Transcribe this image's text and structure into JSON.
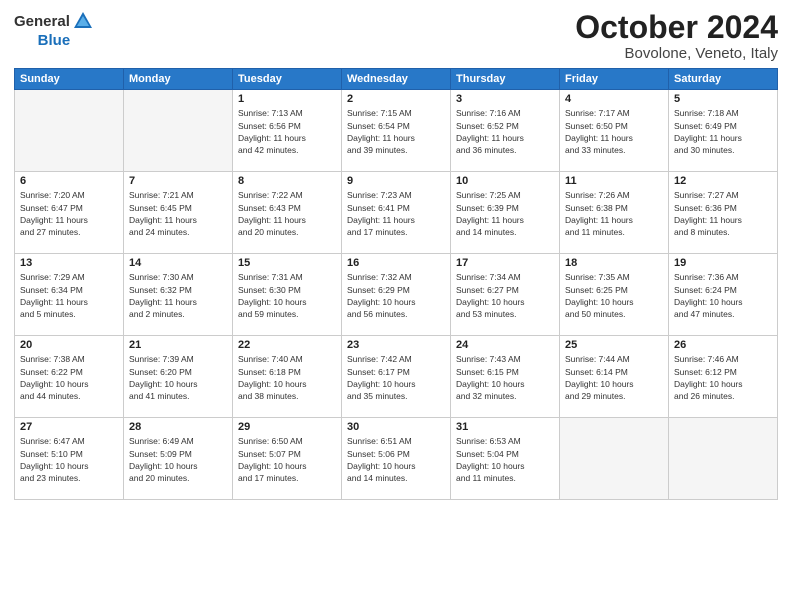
{
  "header": {
    "logo_general": "General",
    "logo_blue": "Blue",
    "month": "October 2024",
    "location": "Bovolone, Veneto, Italy"
  },
  "weekdays": [
    "Sunday",
    "Monday",
    "Tuesday",
    "Wednesday",
    "Thursday",
    "Friday",
    "Saturday"
  ],
  "weeks": [
    [
      {
        "day": "",
        "info": ""
      },
      {
        "day": "",
        "info": ""
      },
      {
        "day": "1",
        "info": "Sunrise: 7:13 AM\nSunset: 6:56 PM\nDaylight: 11 hours\nand 42 minutes."
      },
      {
        "day": "2",
        "info": "Sunrise: 7:15 AM\nSunset: 6:54 PM\nDaylight: 11 hours\nand 39 minutes."
      },
      {
        "day": "3",
        "info": "Sunrise: 7:16 AM\nSunset: 6:52 PM\nDaylight: 11 hours\nand 36 minutes."
      },
      {
        "day": "4",
        "info": "Sunrise: 7:17 AM\nSunset: 6:50 PM\nDaylight: 11 hours\nand 33 minutes."
      },
      {
        "day": "5",
        "info": "Sunrise: 7:18 AM\nSunset: 6:49 PM\nDaylight: 11 hours\nand 30 minutes."
      }
    ],
    [
      {
        "day": "6",
        "info": "Sunrise: 7:20 AM\nSunset: 6:47 PM\nDaylight: 11 hours\nand 27 minutes."
      },
      {
        "day": "7",
        "info": "Sunrise: 7:21 AM\nSunset: 6:45 PM\nDaylight: 11 hours\nand 24 minutes."
      },
      {
        "day": "8",
        "info": "Sunrise: 7:22 AM\nSunset: 6:43 PM\nDaylight: 11 hours\nand 20 minutes."
      },
      {
        "day": "9",
        "info": "Sunrise: 7:23 AM\nSunset: 6:41 PM\nDaylight: 11 hours\nand 17 minutes."
      },
      {
        "day": "10",
        "info": "Sunrise: 7:25 AM\nSunset: 6:39 PM\nDaylight: 11 hours\nand 14 minutes."
      },
      {
        "day": "11",
        "info": "Sunrise: 7:26 AM\nSunset: 6:38 PM\nDaylight: 11 hours\nand 11 minutes."
      },
      {
        "day": "12",
        "info": "Sunrise: 7:27 AM\nSunset: 6:36 PM\nDaylight: 11 hours\nand 8 minutes."
      }
    ],
    [
      {
        "day": "13",
        "info": "Sunrise: 7:29 AM\nSunset: 6:34 PM\nDaylight: 11 hours\nand 5 minutes."
      },
      {
        "day": "14",
        "info": "Sunrise: 7:30 AM\nSunset: 6:32 PM\nDaylight: 11 hours\nand 2 minutes."
      },
      {
        "day": "15",
        "info": "Sunrise: 7:31 AM\nSunset: 6:30 PM\nDaylight: 10 hours\nand 59 minutes."
      },
      {
        "day": "16",
        "info": "Sunrise: 7:32 AM\nSunset: 6:29 PM\nDaylight: 10 hours\nand 56 minutes."
      },
      {
        "day": "17",
        "info": "Sunrise: 7:34 AM\nSunset: 6:27 PM\nDaylight: 10 hours\nand 53 minutes."
      },
      {
        "day": "18",
        "info": "Sunrise: 7:35 AM\nSunset: 6:25 PM\nDaylight: 10 hours\nand 50 minutes."
      },
      {
        "day": "19",
        "info": "Sunrise: 7:36 AM\nSunset: 6:24 PM\nDaylight: 10 hours\nand 47 minutes."
      }
    ],
    [
      {
        "day": "20",
        "info": "Sunrise: 7:38 AM\nSunset: 6:22 PM\nDaylight: 10 hours\nand 44 minutes."
      },
      {
        "day": "21",
        "info": "Sunrise: 7:39 AM\nSunset: 6:20 PM\nDaylight: 10 hours\nand 41 minutes."
      },
      {
        "day": "22",
        "info": "Sunrise: 7:40 AM\nSunset: 6:18 PM\nDaylight: 10 hours\nand 38 minutes."
      },
      {
        "day": "23",
        "info": "Sunrise: 7:42 AM\nSunset: 6:17 PM\nDaylight: 10 hours\nand 35 minutes."
      },
      {
        "day": "24",
        "info": "Sunrise: 7:43 AM\nSunset: 6:15 PM\nDaylight: 10 hours\nand 32 minutes."
      },
      {
        "day": "25",
        "info": "Sunrise: 7:44 AM\nSunset: 6:14 PM\nDaylight: 10 hours\nand 29 minutes."
      },
      {
        "day": "26",
        "info": "Sunrise: 7:46 AM\nSunset: 6:12 PM\nDaylight: 10 hours\nand 26 minutes."
      }
    ],
    [
      {
        "day": "27",
        "info": "Sunrise: 6:47 AM\nSunset: 5:10 PM\nDaylight: 10 hours\nand 23 minutes."
      },
      {
        "day": "28",
        "info": "Sunrise: 6:49 AM\nSunset: 5:09 PM\nDaylight: 10 hours\nand 20 minutes."
      },
      {
        "day": "29",
        "info": "Sunrise: 6:50 AM\nSunset: 5:07 PM\nDaylight: 10 hours\nand 17 minutes."
      },
      {
        "day": "30",
        "info": "Sunrise: 6:51 AM\nSunset: 5:06 PM\nDaylight: 10 hours\nand 14 minutes."
      },
      {
        "day": "31",
        "info": "Sunrise: 6:53 AM\nSunset: 5:04 PM\nDaylight: 10 hours\nand 11 minutes."
      },
      {
        "day": "",
        "info": ""
      },
      {
        "day": "",
        "info": ""
      }
    ]
  ]
}
